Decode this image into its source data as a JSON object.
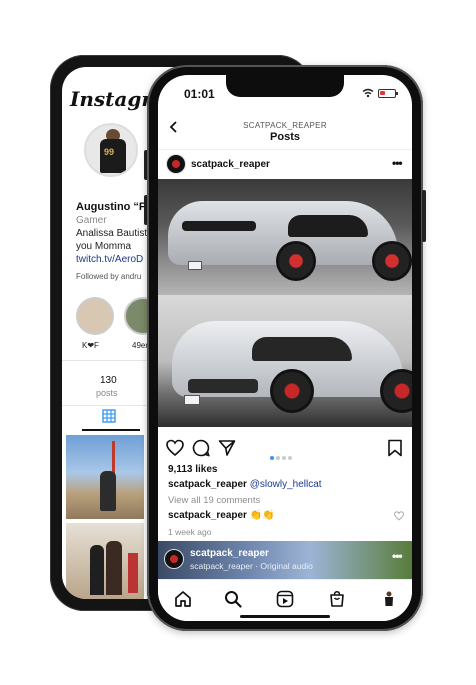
{
  "back_phone": {
    "app_logo": "Instagram",
    "profile": {
      "name": "Augustino “Fine",
      "category": "Gamer",
      "bio_line1": "Analissa Bautista",
      "bio_line2": "you Momma",
      "link": "twitch.tv/AeroD",
      "followed_by": "Followed by andru",
      "jersey_number": "99"
    },
    "highlights": [
      {
        "label": "K❤F"
      },
      {
        "label": "49ers"
      }
    ],
    "stats": {
      "posts_count": "130",
      "posts_label": "posts"
    }
  },
  "front_phone": {
    "status_bar": {
      "time": "01:01"
    },
    "header": {
      "username": "SCATPACK_REAPER",
      "title": "Posts"
    },
    "post": {
      "username": "scatpack_reaper",
      "likes": "9,113 likes",
      "caption_user": "scatpack_reaper",
      "caption_mention": "@slowly_hellcat",
      "view_all_comments": "View all 19 comments",
      "comment_user": "scatpack_reaper",
      "comment_text": "👏👏",
      "time_ago": "1 week ago",
      "carousel_dots": 4,
      "carousel_active": 0
    },
    "next_post": {
      "username": "scatpack_reaper",
      "audio": "scatpack_reaper · Original audio"
    },
    "bottom_nav": [
      "home-icon",
      "search-icon",
      "reels-icon",
      "shop-icon",
      "profile-icon"
    ]
  },
  "colors": {
    "accent_blue": "#3897f0",
    "link_blue": "#1e3a8a",
    "muted": "#8e8e8e"
  }
}
